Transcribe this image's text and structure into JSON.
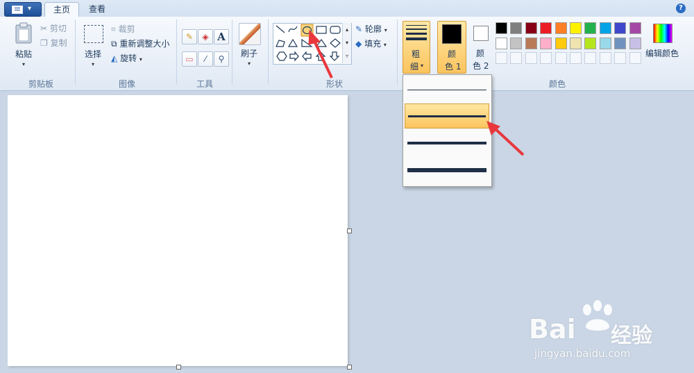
{
  "tabs": {
    "home": "主页",
    "view": "查看"
  },
  "help_label": "?",
  "clipboard": {
    "paste": "粘贴",
    "cut": "剪切",
    "copy": "复制",
    "group": "剪贴板"
  },
  "image": {
    "select": "选择",
    "crop": "裁剪",
    "resize": "重新调整大小",
    "rotate": "旋转",
    "group": "图像"
  },
  "tools": {
    "text_glyph": "A",
    "group": "工具"
  },
  "brushes": {
    "label": "刷子"
  },
  "shapes": {
    "outline": "轮廓",
    "fill": "填充",
    "group": "形状"
  },
  "size": {
    "line1": "粗",
    "line2": "细"
  },
  "color1": {
    "line1": "颜",
    "line2": "色 1"
  },
  "color2": {
    "line1": "颜",
    "line2": "色 2"
  },
  "colors": {
    "group": "颜色",
    "edit": "编辑颜色",
    "row1": [
      "#000000",
      "#7f7f7f",
      "#880015",
      "#ed1c24",
      "#ff7f27",
      "#fff200",
      "#22b14c",
      "#00a2e8",
      "#3f48cc",
      "#a349a4"
    ],
    "row2": [
      "#ffffff",
      "#c3c3c3",
      "#b97a57",
      "#ffaec9",
      "#ffc90e",
      "#efe4b0",
      "#b5e61d",
      "#99d9ea",
      "#7092be",
      "#c8bfe7"
    ],
    "selected_color1": "#000000",
    "selected_color2": "#ffffff"
  },
  "size_menu": {
    "options": [
      "1px",
      "3px",
      "5px",
      "8px"
    ],
    "selected_index": 1
  },
  "watermark": {
    "brand": "Bai",
    "brand2": "经验",
    "url": "jingyan.baidu.com"
  },
  "annotation_arrow_color": "#e8383d"
}
